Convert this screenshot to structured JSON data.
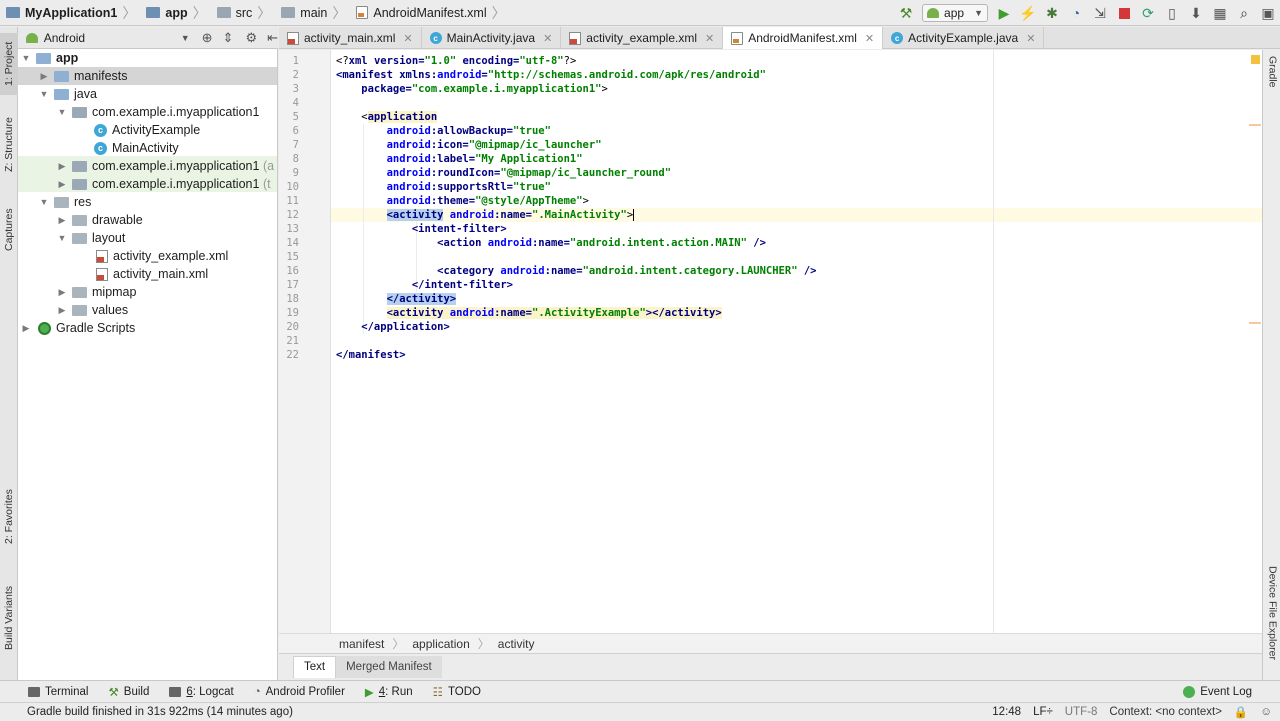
{
  "breadcrumb": {
    "project": "MyApplication1",
    "module": "app",
    "src": "src",
    "main": "main",
    "file": "AndroidManifest.xml"
  },
  "toolbar": {
    "run_config": "app"
  },
  "left_strip": {
    "project": "1: Project",
    "structure": "Z: Structure",
    "captures": "Captures",
    "favorites": "2: Favorites",
    "build_variants": "Build Variants"
  },
  "right_strip": {
    "gradle": "Gradle",
    "device_explorer": "Device File Explorer"
  },
  "project_panel": {
    "view_mode": "Android",
    "tree": [
      {
        "label": "app",
        "bold": true
      },
      {
        "label": "manifests"
      },
      {
        "label": "java"
      },
      {
        "label": "com.example.i.myapplication1"
      },
      {
        "label": "ActivityExample"
      },
      {
        "label": "MainActivity"
      },
      {
        "label": "com.example.i.myapplication1",
        "suffix": "(a"
      },
      {
        "label": "com.example.i.myapplication1",
        "suffix": "(t"
      },
      {
        "label": "res"
      },
      {
        "label": "drawable"
      },
      {
        "label": "layout"
      },
      {
        "label": "activity_example.xml"
      },
      {
        "label": "activity_main.xml"
      },
      {
        "label": "mipmap"
      },
      {
        "label": "values"
      },
      {
        "label": "Gradle Scripts"
      }
    ]
  },
  "editor_tabs": [
    {
      "label": "activity_main.xml"
    },
    {
      "label": "MainActivity.java"
    },
    {
      "label": "activity_example.xml"
    },
    {
      "label": "AndroidManifest.xml",
      "active": true
    },
    {
      "label": "ActivityExample.java"
    }
  ],
  "code": {
    "line_numbers": [
      "1",
      "2",
      "3",
      "4",
      "5",
      "6",
      "7",
      "8",
      "9",
      "10",
      "11",
      "12",
      "13",
      "14",
      "15",
      "16",
      "17",
      "18",
      "19",
      "20",
      "21",
      "22"
    ],
    "l1_a": "<?",
    "l1_b": "xml",
    "l1_c": " version=",
    "l1_d": "\"1.0\"",
    "l1_e": " encoding=",
    "l1_f": "\"utf-8\"",
    "l1_g": "?>",
    "l2_a": "<manifest ",
    "l2_b": "xmlns:",
    "l2_c": "android",
    "l2_d": "=",
    "l2_e": "\"http://schemas.android.com/apk/res/android\"",
    "l3_a": "    package=",
    "l3_b": "\"com.example.i.myapplication1\"",
    "l3_c": ">",
    "l5_a": "    <",
    "l5_b": "application",
    "l6_a": "        android",
    "l6_b": ":allowBackup=",
    "l6_c": "\"true\"",
    "l7_a": "        android",
    "l7_b": ":icon=",
    "l7_c": "\"@mipmap/ic_launcher\"",
    "l8_a": "        android",
    "l8_b": ":label=",
    "l8_c": "\"My Application1\"",
    "l9_a": "        android",
    "l9_b": ":roundIcon=",
    "l9_c": "\"@mipmap/ic_launcher_round\"",
    "l10_a": "        android",
    "l10_b": ":supportsRtl=",
    "l10_c": "\"true\"",
    "l11_a": "        android",
    "l11_b": ":theme=",
    "l11_c": "\"@style/AppTheme\"",
    "l11_d": ">",
    "l12_pre": "        ",
    "l12_a": "<activity",
    "l12_b": " android",
    "l12_c": ":name=",
    "l12_d": "\".MainActivity\"",
    "l12_e": ">",
    "l13_a": "            <intent-filter>",
    "l14_a": "                <action ",
    "l14_b": "android",
    "l14_c": ":name=",
    "l14_d": "\"android.intent.action.MAIN\"",
    "l14_e": " />",
    "l16_a": "                <category ",
    "l16_b": "android",
    "l16_c": ":name=",
    "l16_d": "\"android.intent.category.LAUNCHER\"",
    "l16_e": " />",
    "l17_a": "            </intent-filter>",
    "l18_pre": "        ",
    "l18_a": "</activity>",
    "l19_pre": "        ",
    "l19_a": "<activity ",
    "l19_b": "android",
    "l19_c": ":name=",
    "l19_d": "\".ActivityExample\"",
    "l19_e": "></activity>",
    "l20_a": "    </application>",
    "l22_a": "</manifest>"
  },
  "editor_breadcrumb": [
    "manifest",
    "application",
    "activity"
  ],
  "manifest_tabs": {
    "text": "Text",
    "merged": "Merged Manifest"
  },
  "bottom_tools": {
    "terminal": "Terminal",
    "build": "Build",
    "logcat_num": "6",
    "logcat": ": Logcat",
    "profiler": "Android Profiler",
    "run_num": "4",
    "run": ": Run",
    "todo": "TODO",
    "event_log": "Event Log"
  },
  "status": {
    "message": "Gradle build finished in 31s 922ms (14 minutes ago)",
    "position": "12:48",
    "line_sep": "LF÷",
    "encoding": "UTF-8",
    "context": "Context: <no context>"
  }
}
